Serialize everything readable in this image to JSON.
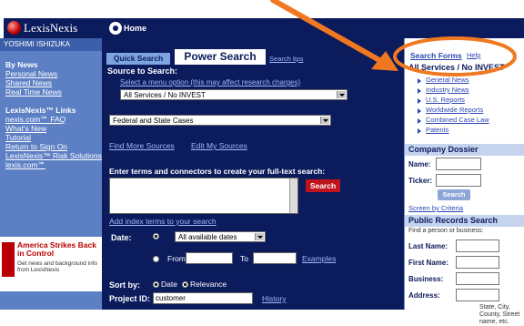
{
  "header": {
    "logo_text": "LexisNexis",
    "home_label": "Home"
  },
  "leftnav": {
    "user": "YOSHIMI ISHIZUKA",
    "section1_title": "By News",
    "section1_links": [
      "Personal News",
      "Shared News",
      "Real Time News"
    ],
    "section2_title": "LexisNexis™ Links",
    "section2_links": [
      "nexis.com℠ FAQ",
      "What's New",
      "Tutorial",
      "Return to Sign On",
      "LexisNexis™ Risk Solutions",
      "lexis.com℠"
    ],
    "ad_title": "America Strikes Back in Control",
    "ad_sub": "Get news and background info from LexisNexis"
  },
  "main": {
    "tab_quick": "Quick Search",
    "tab_power": "Power Search",
    "tab_terms": "Search tips",
    "source_label": "Source to Search:",
    "source_hint": "Select a menu option (this may affect research charges)",
    "source_select1": "All Services / No INVEST",
    "source_select2": "Federal and State Cases",
    "find_more": "Find More Sources",
    "edit_sources": "Edit My Sources",
    "terms_label": "Enter terms and connectors to create your full-text search:",
    "search_button": "Search",
    "add_index": "Add index terms to your search",
    "date_label": "Date:",
    "date_select": "All available dates",
    "from_label": "From",
    "to_label": "To",
    "examples": "Examples",
    "sortby_label": "Sort by:",
    "sort_date": "Date",
    "sort_relevance": "Relevance",
    "project_label": "Project ID:",
    "project_value": "customer",
    "history": "History"
  },
  "rightcol": {
    "search_forms": "Search Forms",
    "help": "Help",
    "all_services": "All Services / No INVEST",
    "forms": [
      "General News",
      "Industry News",
      "U.S. Reports",
      "Worldwide Reports",
      "Combined Case Law",
      "Patents"
    ],
    "company_dossier": "Company Dossier",
    "name_label": "Name:",
    "ticker_label": "Ticker:",
    "go_button": "Search",
    "screen_link": "Screen by Criteria",
    "public_records": "Public Records Search",
    "pr_hint": "Find a person or business:",
    "last_name": "Last Name:",
    "first_name": "First Name:",
    "business": "Business:",
    "address": "Address:",
    "state_hint": "State, City, County, Street name, etc."
  },
  "colors": {
    "navy": "#0b1b5c",
    "leftnav": "#5d7fc4",
    "accent_red": "#c0141c",
    "annotation": "#f07820"
  }
}
